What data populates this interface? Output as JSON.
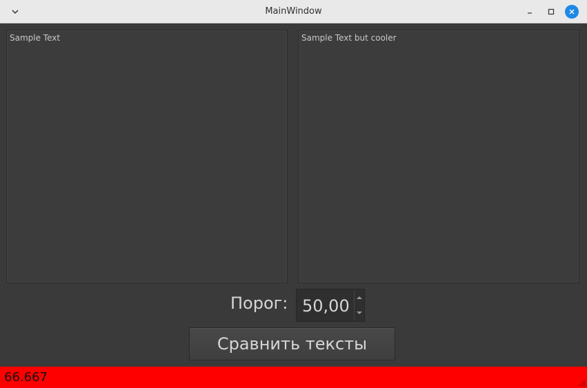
{
  "window": {
    "title": "MainWindow",
    "icons": {
      "menu": "chevron-down-icon",
      "minimize": "minimize-icon",
      "maximize": "maximize-icon",
      "close": "close-icon"
    },
    "accent_color": "#1e88e5"
  },
  "panels": {
    "left_text": "Sample Text",
    "right_text": "Sample Text but cooler"
  },
  "threshold": {
    "label": "Порог:",
    "value": "50,00"
  },
  "compare_button": {
    "label": "Сравнить тексты"
  },
  "status": {
    "value": "66.667",
    "background_color": "#ff0000"
  }
}
